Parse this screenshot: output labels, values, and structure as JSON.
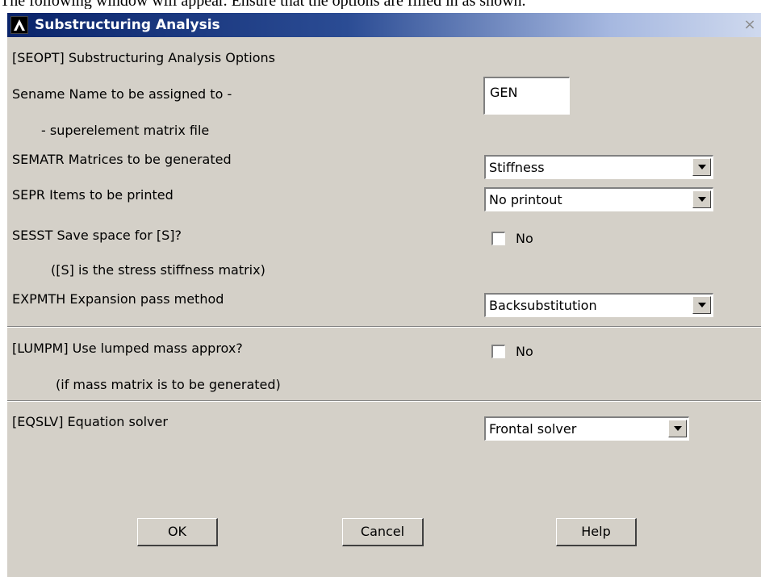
{
  "page_caption": "The following window will appear. Ensure that the options are filled in as shown.",
  "window": {
    "title": "Substructuring Analysis",
    "close_glyph": "×"
  },
  "section_heading": "[SEOPT]  Substructuring Analysis Options",
  "sename": {
    "label": "Sename  Name to be assigned to -",
    "sublabel": "- superelement matrix file",
    "value": "GEN"
  },
  "sematr": {
    "label": "SEMATR  Matrices to be generated",
    "value": "Stiffness"
  },
  "sepr": {
    "label": "SEPR    Items to be printed",
    "value": "No printout"
  },
  "sesst": {
    "label": "SESST   Save space for [S]?",
    "sublabel": "([S] is the stress stiffness matrix)",
    "checkbox_label": "No",
    "checked": false
  },
  "expmth": {
    "label": "EXPMTH Expansion pass method",
    "value": "Backsubstitution"
  },
  "lumpm": {
    "label": "[LUMPM]  Use lumped mass approx?",
    "sublabel": "(if mass matrix is to be generated)",
    "checkbox_label": "No",
    "checked": false
  },
  "eqslv": {
    "label": "[EQSLV]  Equation solver",
    "value": "Frontal solver"
  },
  "buttons": {
    "ok": "OK",
    "cancel": "Cancel",
    "help": "Help"
  },
  "icons": {
    "app": "ansys-logo-icon",
    "close": "close-icon",
    "dropdown": "chevron-down-icon"
  }
}
